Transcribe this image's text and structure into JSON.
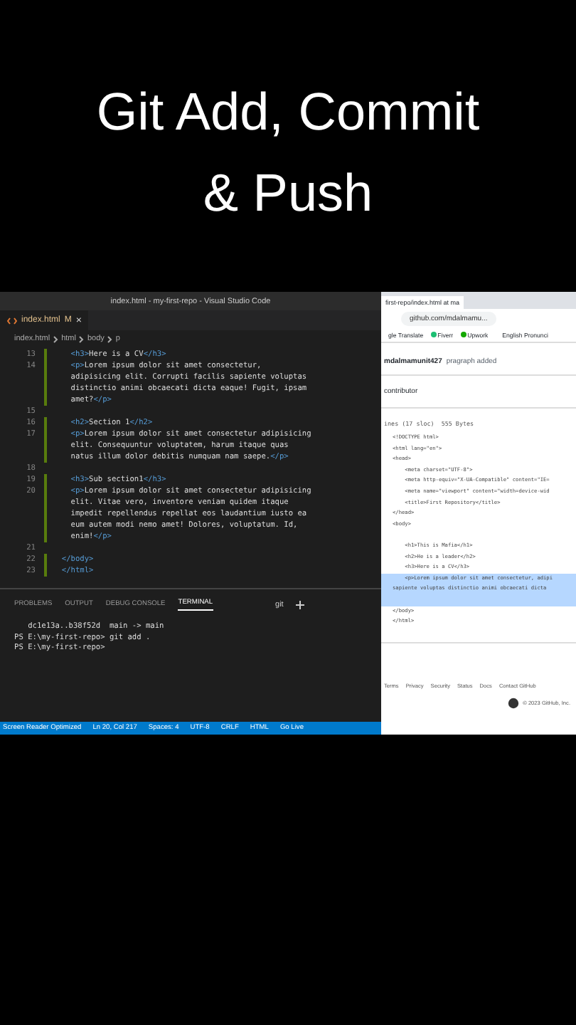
{
  "title": "Git Add, Commit & Push",
  "vscode": {
    "window_title": "index.html - my-first-repo - Visual Studio Code",
    "tab": {
      "label": "index.html",
      "badge": "M",
      "close": "×"
    },
    "breadcrumbs": [
      "index.html",
      "html",
      "body",
      "p"
    ],
    "lines": [
      {
        "number": "13",
        "text": "    <h3>Here is a CV</h3>"
      },
      {
        "number": "14",
        "text": "    <p>Lorem ipsum dolor sit amet consectetur,"
      },
      {
        "text": "    adipisicing elit. Corrupti facilis sapiente voluptas"
      },
      {
        "text": "    distinctio animi obcaecati dicta eaque! Fugit, ipsam"
      },
      {
        "text": "    amet?</p>"
      },
      {
        "number": "15"
      },
      {
        "number": "16",
        "text": "    <h2>Section 1</h2>"
      },
      {
        "number": "17",
        "text": "    <p>Lorem ipsum dolor sit amet consectetur adipisicing"
      },
      {
        "text": "    elit. Consequuntur voluptatem, harum itaque quas"
      },
      {
        "text": "    natus illum dolor debitis numquam nam saepe.</p>"
      },
      {
        "number": "18"
      },
      {
        "number": "19",
        "text": "    <h3>Sub section1</h3>"
      },
      {
        "number": "20",
        "text": "    <p>Lorem ipsum dolor sit amet consectetur adipisicing"
      },
      {
        "text": "    elit. Vitae vero, inventore veniam quidem itaque"
      },
      {
        "text": "    impedit repellendus repellat eos laudantium iusto ea"
      },
      {
        "text": "    eum autem modi nemo amet! Dolores, voluptatum. Id,"
      },
      {
        "text": "    enim!</p>"
      },
      {
        "number": "21"
      },
      {
        "number": "22",
        "text": "  </body>"
      },
      {
        "number": "23",
        "text": "  </html>"
      }
    ],
    "panel_tabs": [
      {
        "label": "PROBLEMS",
        "selected": false
      },
      {
        "label": "OUTPUT",
        "selected": false
      },
      {
        "label": "DEBUG CONSOLE",
        "selected": false
      },
      {
        "label": "TERMINAL",
        "selected": true
      }
    ],
    "terminal_name": "git",
    "terminal_lines": [
      "   dc1e13a..b38f52d  main -> main",
      "PS E:\\my-first-repo> git add .",
      "PS E:\\my-first-repo> "
    ],
    "status": [
      "Screen Reader Optimized",
      "Ln 20, Col 217",
      "Spaces: 4",
      "UTF-8",
      "CRLF",
      "HTML",
      "Go Live"
    ]
  },
  "browser": {
    "tab_title": "first-repo/index.html at ma",
    "url": "github.com/mdalmamu...",
    "bookmarks": [
      {
        "label": "gle Translate",
        "color": "#ffffff"
      },
      {
        "label": "Fiverr",
        "color": "#1dbf73"
      },
      {
        "label": "Upwork",
        "color": "#14a800"
      },
      {
        "label": "English Pronunci",
        "color": "#ffffff"
      }
    ],
    "author": "mdalmamunit427",
    "commit_message": "pragraph added",
    "contributors": "contributor",
    "file_info": "ines (17 sloc)  555 Bytes",
    "code": [
      {
        "text": "<!DOCTYPE html>",
        "highlighted": false
      },
      {
        "text": "<html lang=\"en\">",
        "highlighted": false
      },
      {
        "text": "<head>",
        "highlighted": false
      },
      {
        "text": "    <meta charset=\"UTF-8\">",
        "highlighted": false
      },
      {
        "text": "    <meta http-equiv=\"X-UA-Compatible\" content=\"IE=",
        "highlighted": false
      },
      {
        "text": "    <meta name=\"viewport\" content=\"width=device-wid",
        "highlighted": false
      },
      {
        "text": "    <title>First Repository</title>",
        "highlighted": false
      },
      {
        "text": "</head>",
        "highlighted": false
      },
      {
        "text": "<body>",
        "highlighted": false
      },
      {
        "highlighted": false
      },
      {
        "text": "    <h1>This is Mafia</h1>",
        "highlighted": false
      },
      {
        "text": "    <h2>He is a leader</h2>",
        "highlighted": false
      },
      {
        "text": "    <h3>Here is a CV</h3>",
        "highlighted": false
      },
      {
        "text": "    <p>Lorem ipsum dolor sit amet consectetur, adipi",
        "highlighted": true
      },
      {
        "text": "sapiente voluptas distinctio animi obcaecati dicta",
        "highlighted": true
      },
      {
        "highlighted": true
      },
      {
        "text": "</body>",
        "highlighted": false
      },
      {
        "text": "</html>",
        "highlighted": false
      }
    ],
    "footer_links": [
      "Terms",
      "Privacy",
      "Security",
      "Status",
      "Docs",
      "Contact GitHub"
    ],
    "copyright": "© 2023 GitHub, Inc."
  }
}
